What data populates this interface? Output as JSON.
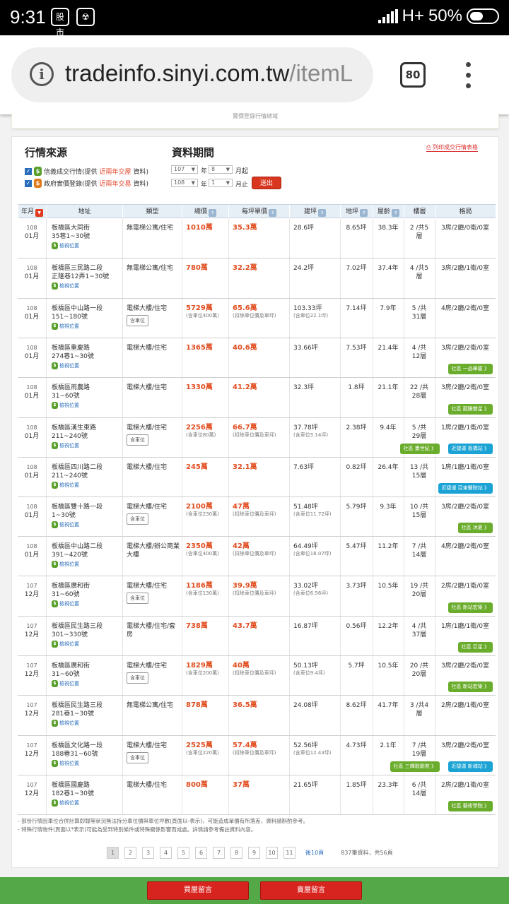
{
  "status": {
    "time": "9:31",
    "notif1": "股市",
    "notif2": "☢",
    "network": "H+",
    "battery": "50%"
  },
  "browser": {
    "url_host": "tradeinfo.sinyi.com.tw",
    "url_path": "/itemL",
    "tab_count": "80"
  },
  "prev_section_text": "實價登錄行情總域",
  "filters": {
    "source_title": "行情來源",
    "period_title": "資料期間",
    "src1": {
      "a": "信義成交行情(提供",
      "b": "近兩年交屋",
      "c": "資料)"
    },
    "src2": {
      "a": "政府實價登錄(提供",
      "b": "近兩年交易",
      "c": "資料)"
    },
    "from_year": "107",
    "from_month": "8",
    "to_year": "108",
    "to_month": "1",
    "year_label": "年",
    "from_suffix": "月起",
    "to_suffix": "月止",
    "submit": "送出",
    "print_link": "列印成交行情表格"
  },
  "table": {
    "headers": [
      "年月",
      "地址",
      "類型",
      "總價",
      "每坪單價",
      "建坪",
      "地坪",
      "屋齡",
      "樓層",
      "格局"
    ],
    "pos_label": "檢視位置",
    "parking_label": "含車位",
    "rows": [
      {
        "ym": "108",
        "m": "01月",
        "addr": "板橋區大同街",
        "addr2": "35巷1~30號",
        "type": "無電梯公寓/住宅",
        "park": false,
        "price": "1010萬",
        "psub": "",
        "unit": "35.3萬",
        "usub": "",
        "area": "28.6坪",
        "asub": "",
        "land": "8.65坪",
        "age": "38.3年",
        "floor": "2 /共5",
        "floor2": "層",
        "layout": "3房/2廳/0衛/0室",
        "badges": []
      },
      {
        "ym": "108",
        "m": "01月",
        "addr": "板橋區三民路二段",
        "addr2": "正隆巷12弄1~30號",
        "type": "無電梯公寓/住宅",
        "park": false,
        "price": "780萬",
        "psub": "",
        "unit": "32.2萬",
        "usub": "",
        "area": "24.2坪",
        "asub": "",
        "land": "7.02坪",
        "age": "37.4年",
        "floor": "4 /共5",
        "floor2": "層",
        "layout": "3房/2廳/1衛/0室",
        "badges": []
      },
      {
        "ym": "108",
        "m": "01月",
        "addr": "板橋區中山路一段",
        "addr2": "151~180號",
        "type": "電梯大樓/住宅",
        "park": true,
        "price": "5729萬",
        "psub": "(含車位400萬)",
        "unit": "65.6萬",
        "usub": "(扣除車位價及車坪)",
        "area": "103.33坪",
        "asub": "(含車位22.1坪)",
        "land": "7.14坪",
        "age": "7.9年",
        "floor": "5 /共",
        "floor2": "31層",
        "layout": "4房/2廳/2衛/0室",
        "badges": []
      },
      {
        "ym": "108",
        "m": "01月",
        "addr": "板橋區重慶路",
        "addr2": "274巷1~30號",
        "type": "電梯大樓/住宅",
        "park": false,
        "price": "1365萬",
        "psub": "",
        "unit": "40.6萬",
        "usub": "",
        "area": "33.66坪",
        "asub": "",
        "land": "7.53坪",
        "age": "21.4年",
        "floor": "4 /共",
        "floor2": "12層",
        "layout": "3房/2廳/2衛/0室",
        "badges": [
          {
            "t": "社區 一品華廈 》",
            "c": "green"
          }
        ]
      },
      {
        "ym": "108",
        "m": "01月",
        "addr": "板橋區雨農路",
        "addr2": "31~60號",
        "type": "電梯大樓/住宅",
        "park": false,
        "price": "1330萬",
        "psub": "",
        "unit": "41.2萬",
        "usub": "",
        "area": "32.3坪",
        "asub": "",
        "land": "1.8坪",
        "age": "21.1年",
        "floor": "22 /共",
        "floor2": "28層",
        "layout": "3房/2廳/2衛/0室",
        "badges": [
          {
            "t": "社區 龍騰雙星 》",
            "c": "green"
          }
        ]
      },
      {
        "ym": "108",
        "m": "01月",
        "addr": "板橋區漢生東路",
        "addr2": "211~240號",
        "type": "電梯大樓/住宅",
        "park": true,
        "price": "2256萬",
        "psub": "(含車位80萬)",
        "unit": "66.7萬",
        "usub": "(扣除車位價及車坪)",
        "area": "37.78坪",
        "asub": "(含車位5.14坪)",
        "land": "2.38坪",
        "age": "9.4年",
        "floor": "5 /共",
        "floor2": "29層",
        "layout": "1房/2廳/1衛/0室",
        "badges": [
          {
            "t": "社區 畫世紀 》",
            "c": "green"
          },
          {
            "t": "近捷運 板橋站 》",
            "c": "blue"
          }
        ]
      },
      {
        "ym": "108",
        "m": "01月",
        "addr": "板橋區四川路二段",
        "addr2": "211~240號",
        "type": "電梯大樓/住宅",
        "park": false,
        "price": "245萬",
        "psub": "",
        "unit": "32.1萬",
        "usub": "",
        "area": "7.63坪",
        "asub": "",
        "land": "0.82坪",
        "age": "26.4年",
        "floor": "13 /共",
        "floor2": "15層",
        "layout": "1房/1廳/1衛/0室",
        "badges": [
          {
            "t": "近捷運 亞東醫院站 》",
            "c": "blue"
          }
        ]
      },
      {
        "ym": "108",
        "m": "01月",
        "addr": "板橋區雙十路一段",
        "addr2": "1~30號",
        "type": "電梯大樓/住宅",
        "park": true,
        "price": "2100萬",
        "psub": "(含車位230萬)",
        "unit": "47萬",
        "usub": "(扣除車位價及車坪)",
        "area": "51.48坪",
        "asub": "(含車位11.72坪)",
        "land": "5.79坪",
        "age": "9.3年",
        "floor": "10 /共",
        "floor2": "15層",
        "layout": "3房/2廳/2衛/0室",
        "badges": [
          {
            "t": "社區 沐夏 》",
            "c": "green"
          }
        ]
      },
      {
        "ym": "108",
        "m": "01月",
        "addr": "板橋區中山路二段",
        "addr2": "391~420號",
        "type": "電梯大樓/辦公商業大樓",
        "park": false,
        "price": "2350萬",
        "psub": "(含車位400萬)",
        "unit": "42萬",
        "usub": "(扣除車位價及車坪)",
        "area": "64.49坪",
        "asub": "(含車位18.07坪)",
        "land": "5.47坪",
        "age": "11.2年",
        "floor": "7 /共",
        "floor2": "14層",
        "layout": "4房/2廳/2衛/0室",
        "badges": []
      },
      {
        "ym": "107",
        "m": "12月",
        "addr": "板橋區廣和街",
        "addr2": "31~60號",
        "type": "電梯大樓/住宅",
        "park": true,
        "price": "1186萬",
        "psub": "(含車位130萬)",
        "unit": "39.9萬",
        "usub": "(扣除車位價及車坪)",
        "area": "33.02坪",
        "asub": "(含車位6.56坪)",
        "land": "3.73坪",
        "age": "10.5年",
        "floor": "19 /共",
        "floor2": "20層",
        "layout": "2房/2廳/1衛/0室",
        "badges": [
          {
            "t": "社區 新站宏築 》",
            "c": "green"
          }
        ]
      },
      {
        "ym": "107",
        "m": "12月",
        "addr": "板橋區民生路三段",
        "addr2": "301~330號",
        "type": "電梯大樓/住宅/套房",
        "park": false,
        "price": "738萬",
        "psub": "",
        "unit": "43.7萬",
        "usub": "",
        "area": "16.87坪",
        "asub": "",
        "land": "0.56坪",
        "age": "12.2年",
        "floor": "4 /共",
        "floor2": "37層",
        "layout": "1房/1廳/1衛/0室",
        "badges": [
          {
            "t": "社區 巨星 》",
            "c": "green"
          }
        ]
      },
      {
        "ym": "107",
        "m": "12月",
        "addr": "板橋區廣和街",
        "addr2": "31~60號",
        "type": "電梯大樓/住宅",
        "park": true,
        "price": "1829萬",
        "psub": "(含車位200萬)",
        "unit": "40萬",
        "usub": "(扣除車位價及車坪)",
        "area": "50.13坪",
        "asub": "(含車位9.4坪)",
        "land": "5.7坪",
        "age": "10.5年",
        "floor": "20 /共",
        "floor2": "20層",
        "layout": "3房/2廳/2衛/0室",
        "badges": [
          {
            "t": "社區 新站宏築 》",
            "c": "green"
          }
        ]
      },
      {
        "ym": "107",
        "m": "12月",
        "addr": "板橋區民生路三段",
        "addr2": "281巷1~30號",
        "type": "無電梯公寓/住宅",
        "park": false,
        "price": "878萬",
        "psub": "",
        "unit": "36.5萬",
        "usub": "",
        "area": "24.08坪",
        "asub": "",
        "land": "8.62坪",
        "age": "41.7年",
        "floor": "3 /共4",
        "floor2": "層",
        "layout": "2房/2廳/1衛/0室",
        "badges": []
      },
      {
        "ym": "107",
        "m": "12月",
        "addr": "板橋區文化路一段",
        "addr2": "188巷31~60號",
        "type": "電梯大樓/住宅",
        "park": true,
        "price": "2525萬",
        "psub": "(含車位220萬)",
        "unit": "57.4萬",
        "usub": "(扣除車位價及車坪)",
        "area": "52.56坪",
        "asub": "(含車位12.43坪)",
        "land": "4.73坪",
        "age": "2.1年",
        "floor": "7 /共",
        "floor2": "19層",
        "layout": "3房/2廳/2衛/0室",
        "badges": [
          {
            "t": "社區 三輝歌劇苑 》",
            "c": "green"
          },
          {
            "t": "近捷運 新埔站 》",
            "c": "blue"
          }
        ]
      },
      {
        "ym": "107",
        "m": "12月",
        "addr": "板橋區國慶路",
        "addr2": "182巷1~30號",
        "type": "電梯大樓/住宅",
        "park": false,
        "price": "800萬",
        "psub": "",
        "unit": "37萬",
        "usub": "",
        "area": "21.65坪",
        "asub": "",
        "land": "1.85坪",
        "age": "23.3年",
        "floor": "6 /共",
        "floor2": "14層",
        "layout": "2房/2廳/1衛/0室",
        "badges": [
          {
            "t": "社區 藝術學院 》",
            "c": "green"
          }
        ]
      }
    ]
  },
  "notes": [
    "- 部份行情因車位合併計算即報等狀況無法拆分車位價與車位坪數(頁面以-表示)，可能造成單價有所落差，資料請斟酌參考。",
    "- 特殊行情物件(頁面以*表示)可能為受到特別條件或特殊關係影響而成處。詳情請參考備註資料內容。"
  ],
  "pager": {
    "pages": [
      "1",
      "2",
      "3",
      "4",
      "5",
      "6",
      "7",
      "8",
      "9",
      "10",
      "11"
    ],
    "next": "後10頁",
    "count": "837筆資料，共56頁"
  },
  "bottom": {
    "btn1": "買屋留言",
    "btn2": "賣屋留言"
  }
}
